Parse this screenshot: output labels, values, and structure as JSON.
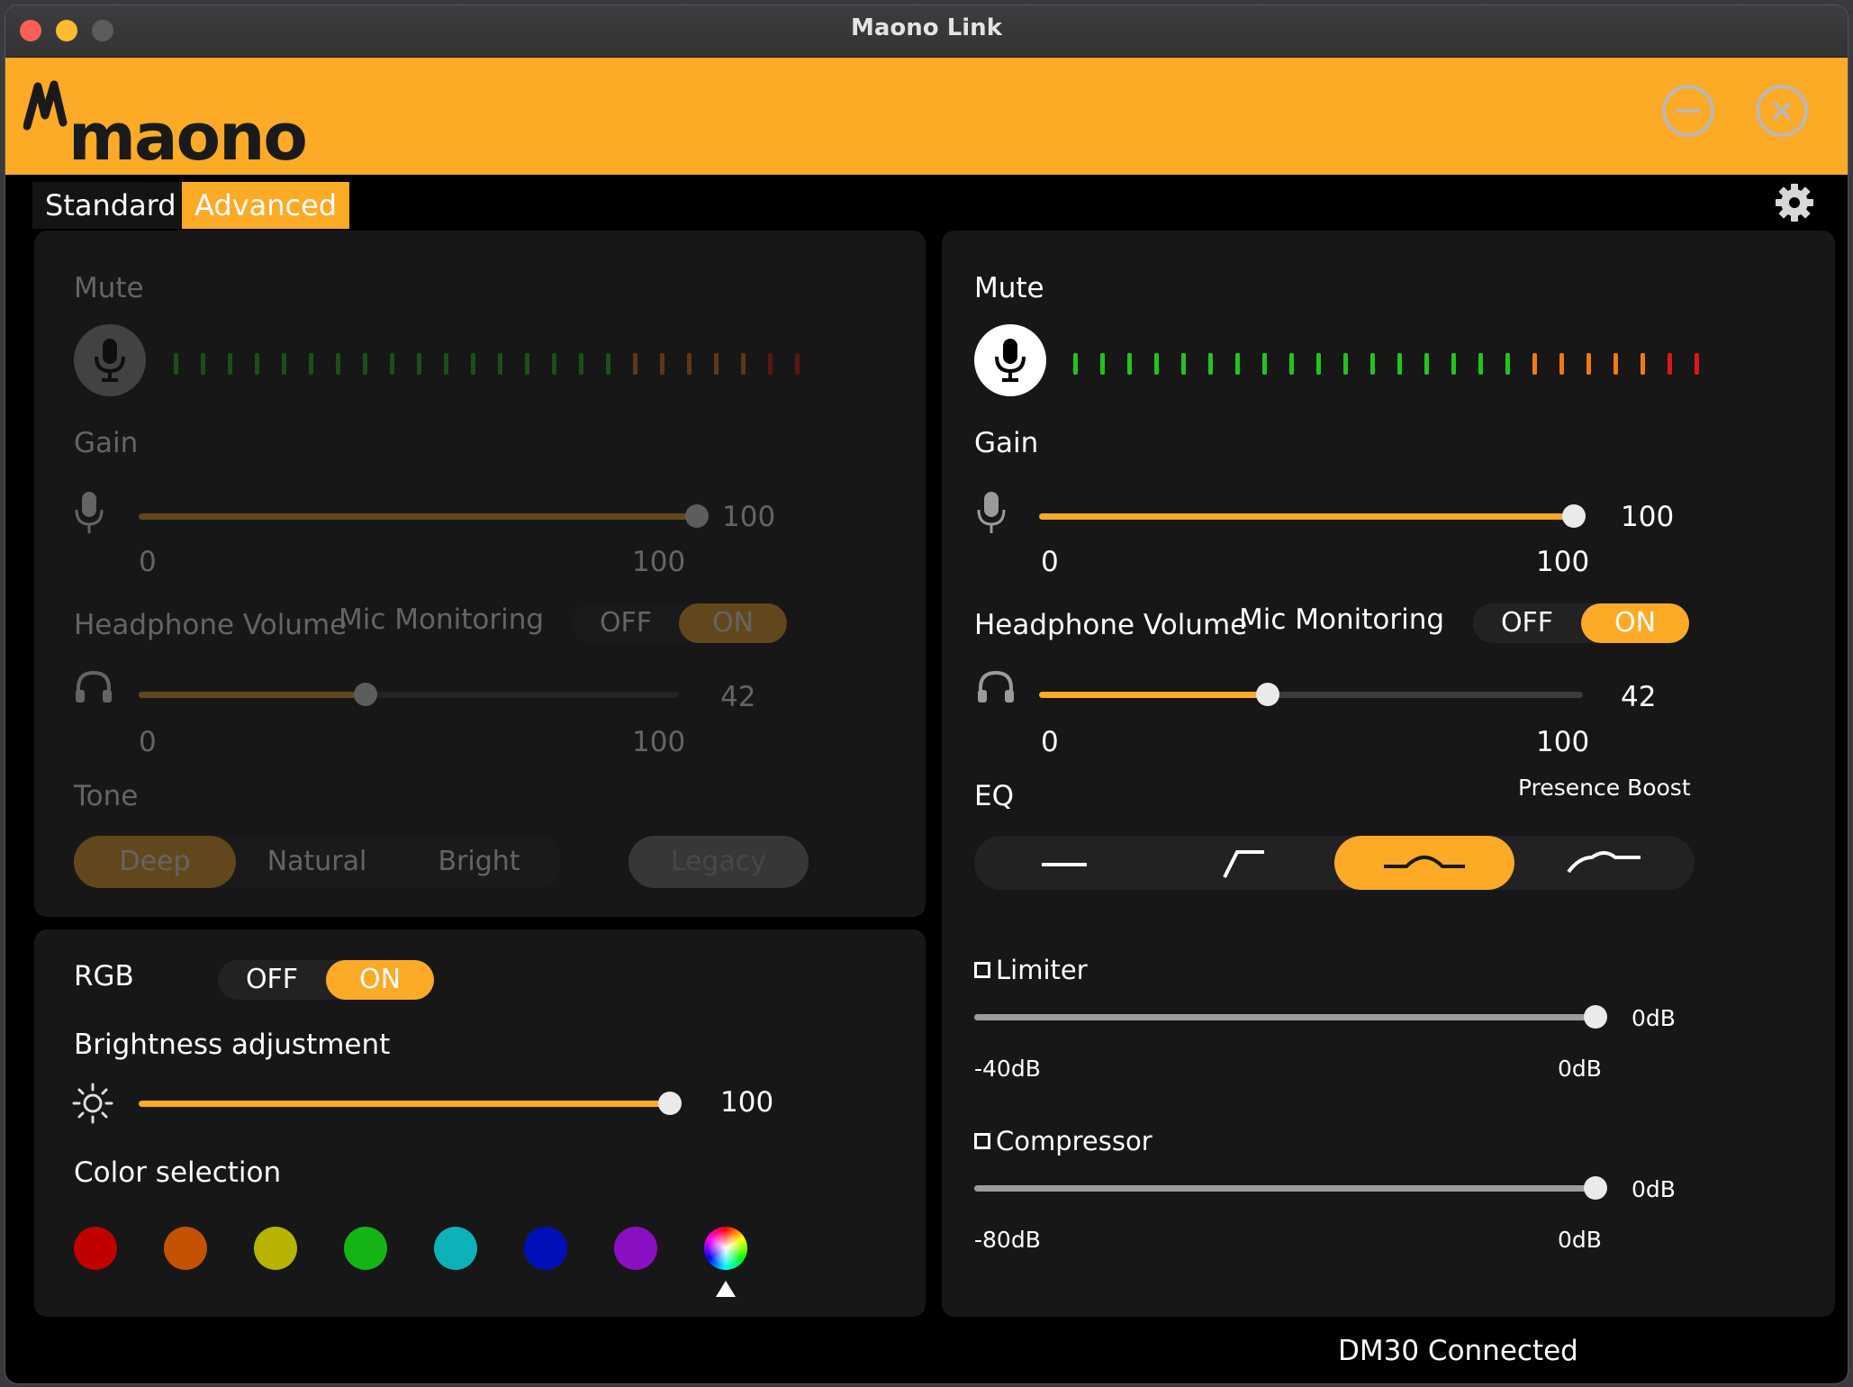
{
  "window": {
    "title": "Maono Link"
  },
  "brand": {
    "logo_text": "maono"
  },
  "tabs": {
    "standard": "Standard",
    "advanced": "Advanced",
    "active": "Advanced"
  },
  "left_panel": {
    "mute_label": "Mute",
    "gain_label": "Gain",
    "gain_value": "100",
    "gain_min": "0",
    "gain_max": "100",
    "gain_level": 1.0,
    "headphone_label": "Headphone Volume",
    "monitoring_label": "Mic Monitoring",
    "off": "OFF",
    "on": "ON",
    "headphone_value": "42",
    "headphone_min": "0",
    "headphone_max": "100",
    "headphone_level": 0.42,
    "tone_label": "Tone",
    "tone_options": [
      "Deep",
      "Natural",
      "Bright"
    ],
    "tone_selected": "Deep",
    "legacy_label": "Legacy"
  },
  "rgb_panel": {
    "rgb_label": "RGB",
    "off": "OFF",
    "on": "ON",
    "brightness_label": "Brightness adjustment",
    "brightness_value": "100",
    "brightness_level": 1.0,
    "color_label": "Color selection",
    "colors": [
      "#c00000",
      "#c45200",
      "#b7b300",
      "#14b414",
      "#0db1b8",
      "#0010b8",
      "#8a0fc2",
      "rainbow"
    ],
    "selected_color": "rainbow"
  },
  "right_panel": {
    "mute_label": "Mute",
    "gain_label": "Gain",
    "gain_value": "100",
    "gain_min": "0",
    "gain_max": "100",
    "gain_level": 1.0,
    "headphone_label": "Headphone Volume",
    "monitoring_label": "Mic Monitoring",
    "off": "OFF",
    "on": "ON",
    "headphone_value": "42",
    "headphone_min": "0",
    "headphone_max": "100",
    "headphone_level": 0.42,
    "eq_label": "EQ",
    "eq_selected_name": "Presence Boost",
    "eq_selected_index": 2,
    "limiter_label": "Limiter",
    "limiter_value": "0dB",
    "limiter_min": "-40dB",
    "limiter_max": "0dB",
    "limiter_level": 1.0,
    "compressor_label": "Compressor",
    "compressor_value": "0dB",
    "compressor_min": "-80dB",
    "compressor_max": "0dB",
    "compressor_level": 1.0
  },
  "status": {
    "connection": "DM30 Connected"
  },
  "colors": {
    "accent": "#fdaa27",
    "panel": "#171717",
    "meter_green": "#21c51b",
    "meter_orange": "#f07a14",
    "meter_red": "#e01616"
  }
}
